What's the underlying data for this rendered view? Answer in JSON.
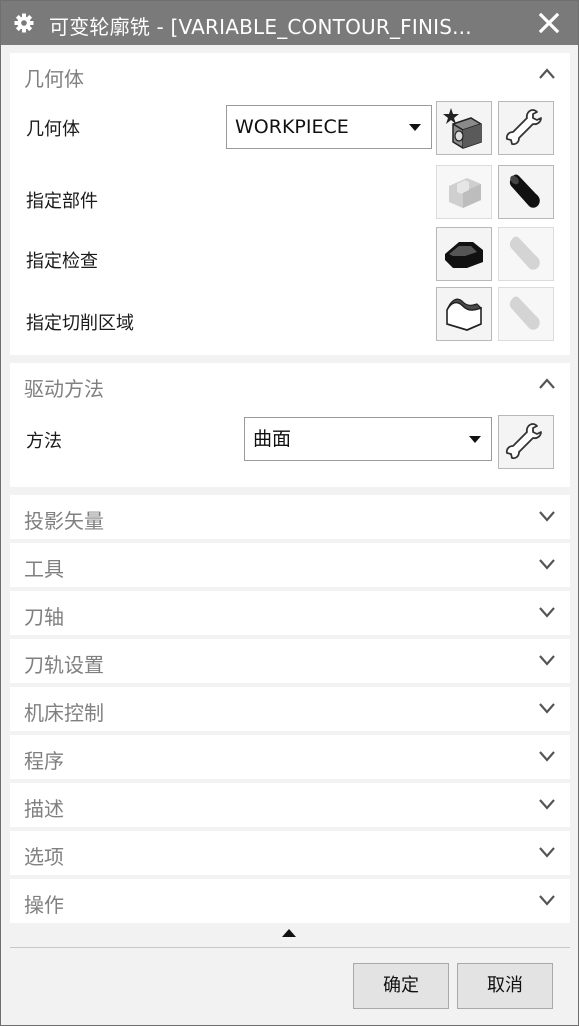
{
  "window": {
    "title": "可变轮廓铣 - [VARIABLE_CONTOUR_FINIS...",
    "gear_icon": "gear-icon",
    "close_icon": "close-icon"
  },
  "geometry_group": {
    "label": "几何体",
    "expanded": true,
    "rows": [
      {
        "label": "几何体",
        "select_value": "WORKPIECE",
        "buttons": [
          "new-geometry-icon",
          "edit-wrench-icon"
        ]
      },
      {
        "label": "指定部件",
        "buttons": [
          "select-part-icon",
          "display-flashlight-icon"
        ]
      },
      {
        "label": "指定检查",
        "buttons": [
          "select-check-icon",
          "display-flashlight-icon"
        ]
      },
      {
        "label": "指定切削区域",
        "buttons": [
          "select-cut-area-icon",
          "display-flashlight-icon"
        ]
      }
    ]
  },
  "drive_group": {
    "label": "驱动方法",
    "expanded": true,
    "method_label": "方法",
    "method_value": "曲面"
  },
  "collapsed_groups": [
    {
      "label": "投影矢量"
    },
    {
      "label": "工具"
    },
    {
      "label": "刀轴"
    },
    {
      "label": "刀轨设置"
    },
    {
      "label": "机床控制"
    },
    {
      "label": "程序"
    },
    {
      "label": "描述"
    },
    {
      "label": "选项"
    },
    {
      "label": "操作"
    }
  ],
  "footer": {
    "ok_label": "确定",
    "cancel_label": "取消"
  },
  "colors": {
    "titlebar": "#7a7a7a",
    "panel_bg": "#f2f2f2",
    "group_bg": "#ffffff",
    "group_label": "#808080"
  }
}
